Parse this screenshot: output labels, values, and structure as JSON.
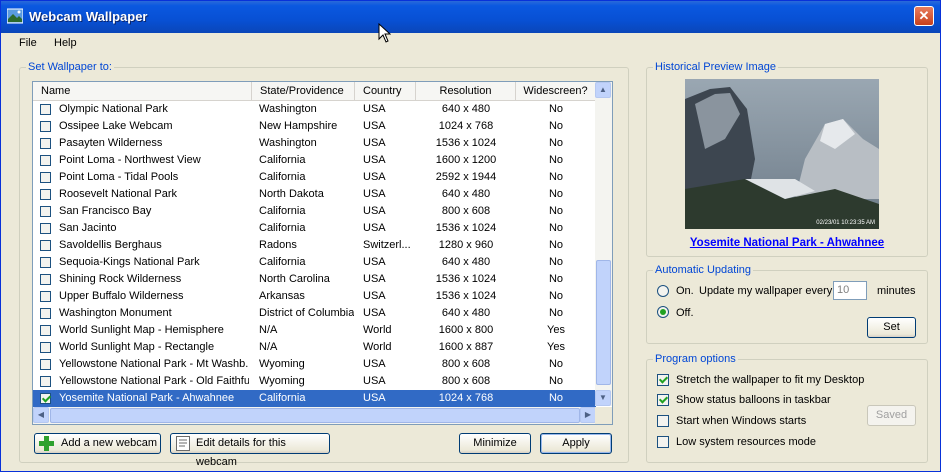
{
  "window": {
    "title": "Webcam Wallpaper",
    "close_glyph": "✕"
  },
  "menu": {
    "items": [
      "File",
      "Help"
    ]
  },
  "left_group": {
    "title": "Set Wallpaper to:"
  },
  "table": {
    "columns": [
      "Name",
      "State/Providence",
      "Country",
      "Resolution",
      "Widescreen?"
    ],
    "rows": [
      {
        "checked": false,
        "name": "Olympic National Park",
        "state": "Washington",
        "country": "USA",
        "resolution": "640 x 480",
        "widescreen": "No"
      },
      {
        "checked": false,
        "name": "Ossipee Lake Webcam",
        "state": "New Hampshire",
        "country": "USA",
        "resolution": "1024 x 768",
        "widescreen": "No"
      },
      {
        "checked": false,
        "name": "Pasayten Wilderness",
        "state": "Washington",
        "country": "USA",
        "resolution": "1536 x 1024",
        "widescreen": "No"
      },
      {
        "checked": false,
        "name": "Point Loma - Northwest View",
        "state": "California",
        "country": "USA",
        "resolution": "1600 x 1200",
        "widescreen": "No"
      },
      {
        "checked": false,
        "name": "Point Loma - Tidal Pools",
        "state": "California",
        "country": "USA",
        "resolution": "2592 x 1944",
        "widescreen": "No"
      },
      {
        "checked": false,
        "name": "Roosevelt National Park",
        "state": "North Dakota",
        "country": "USA",
        "resolution": "640 x 480",
        "widescreen": "No"
      },
      {
        "checked": false,
        "name": "San Francisco Bay",
        "state": "California",
        "country": "USA",
        "resolution": "800 x 608",
        "widescreen": "No"
      },
      {
        "checked": false,
        "name": "San Jacinto",
        "state": "California",
        "country": "USA",
        "resolution": "1536 x 1024",
        "widescreen": "No"
      },
      {
        "checked": false,
        "name": "Savoldellis Berghaus",
        "state": "Radons",
        "country": "Switzerl...",
        "resolution": "1280 x 960",
        "widescreen": "No"
      },
      {
        "checked": false,
        "name": "Sequoia-Kings National Park",
        "state": "California",
        "country": "USA",
        "resolution": "640 x 480",
        "widescreen": "No"
      },
      {
        "checked": false,
        "name": "Shining Rock Wilderness",
        "state": "North Carolina",
        "country": "USA",
        "resolution": "1536 x 1024",
        "widescreen": "No"
      },
      {
        "checked": false,
        "name": "Upper Buffalo Wilderness",
        "state": "Arkansas",
        "country": "USA",
        "resolution": "1536 x 1024",
        "widescreen": "No"
      },
      {
        "checked": false,
        "name": "Washington Monument",
        "state": "District of Columbia",
        "country": "USA",
        "resolution": "640 x 480",
        "widescreen": "No"
      },
      {
        "checked": false,
        "name": "World Sunlight Map - Hemisphere",
        "state": "N/A",
        "country": "World",
        "resolution": "1600 x 800",
        "widescreen": "Yes"
      },
      {
        "checked": false,
        "name": "World Sunlight Map - Rectangle",
        "state": "N/A",
        "country": "World",
        "resolution": "1600 x 887",
        "widescreen": "Yes"
      },
      {
        "checked": false,
        "name": "Yellowstone National Park - Mt Washb...",
        "state": "Wyoming",
        "country": "USA",
        "resolution": "800 x 608",
        "widescreen": "No"
      },
      {
        "checked": false,
        "name": "Yellowstone National Park - Old Faithful",
        "state": "Wyoming",
        "country": "USA",
        "resolution": "800 x 608",
        "widescreen": "No"
      },
      {
        "checked": true,
        "name": "Yosemite National Park - Ahwahnee",
        "state": "California",
        "country": "USA",
        "resolution": "1024 x 768",
        "widescreen": "No",
        "selected": true
      }
    ]
  },
  "buttons": {
    "add_webcam": "Add a new webcam",
    "edit_details": "Edit details for this webcam",
    "minimize": "Minimize",
    "apply": "Apply",
    "set": "Set",
    "saved": "Saved"
  },
  "preview": {
    "title": "Historical Preview Image",
    "timestamp": "02/23/01 10:23:35 AM",
    "link": "Yosemite National Park - Ahwahnee"
  },
  "auto_update": {
    "title": "Automatic Updating",
    "on_label": "On.",
    "update_prefix": "Update my wallpaper every",
    "interval_value": "10",
    "minutes_label": "minutes",
    "off_label": "Off.",
    "selected": "off"
  },
  "program_options": {
    "title": "Program options",
    "options": [
      {
        "label": "Stretch the wallpaper to fit my Desktop",
        "checked": true
      },
      {
        "label": "Show status balloons in taskbar",
        "checked": true
      },
      {
        "label": "Start when Windows starts",
        "checked": false
      },
      {
        "label": "Low system resources mode",
        "checked": false
      }
    ]
  },
  "colors": {
    "accent": "#0046d5",
    "selection": "#316ac5",
    "titlebar": "#0a58e0"
  }
}
